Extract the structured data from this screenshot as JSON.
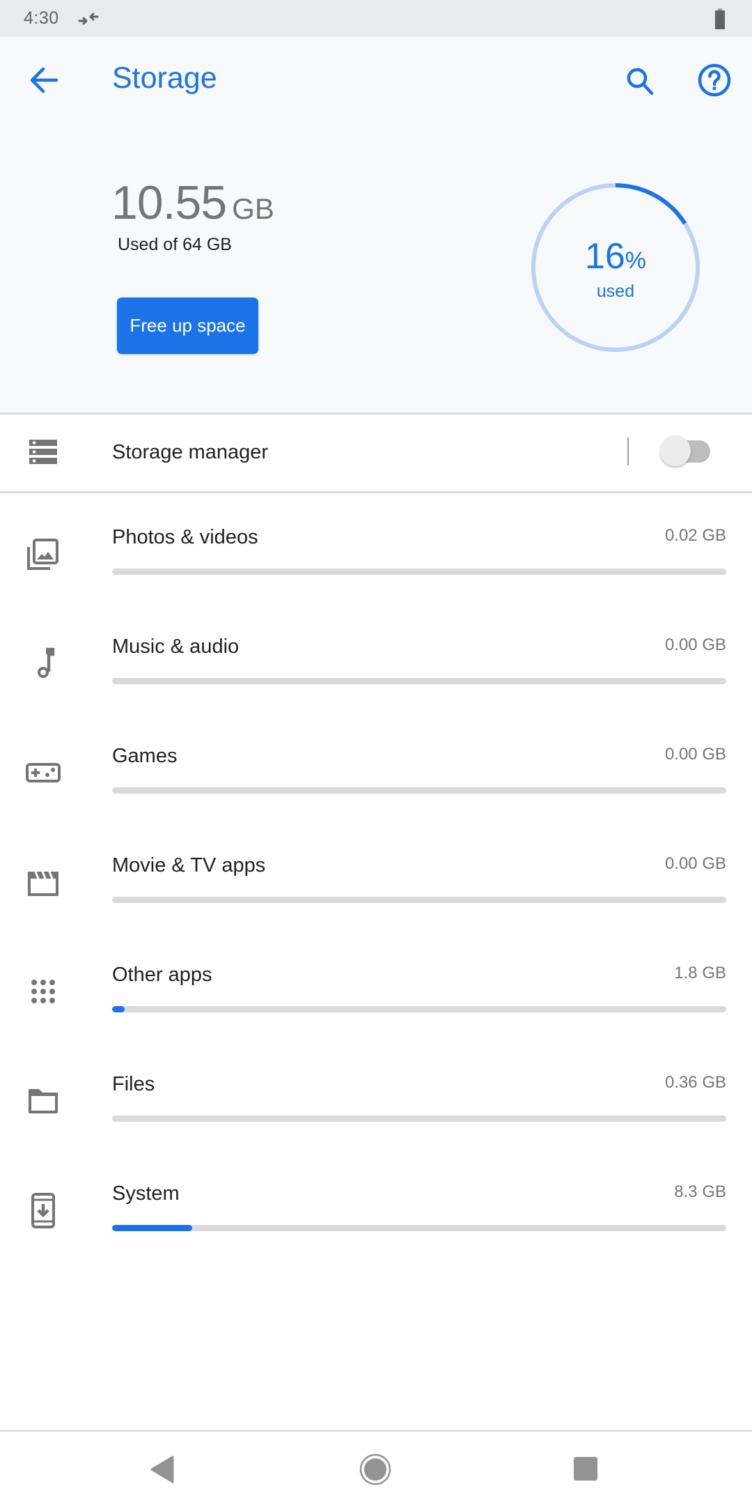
{
  "status_bar": {
    "time": "4:30",
    "icons": [
      "data-saver-icon",
      "battery-icon"
    ]
  },
  "header": {
    "title": "Storage",
    "back_icon": "arrow-back-icon",
    "search_icon": "search-icon",
    "help_icon": "help-circle-icon"
  },
  "summary": {
    "used_value": "10.55",
    "used_unit": "GB",
    "used_of": "Used of 64 GB",
    "free_up_button": "Free up space",
    "percent_value": "16",
    "percent_sign": "%",
    "percent_label": "used",
    "percent_fraction": 0.16
  },
  "storage_manager": {
    "label": "Storage manager",
    "icon": "storage-icon",
    "enabled": false
  },
  "categories": [
    {
      "label": "Photos & videos",
      "size": "0.02 GB",
      "icon": "photo-library-icon",
      "fraction": 0.0
    },
    {
      "label": "Music & audio",
      "size": "0.00 GB",
      "icon": "music-note-icon",
      "fraction": 0.0
    },
    {
      "label": "Games",
      "size": "0.00 GB",
      "icon": "gamepad-icon",
      "fraction": 0.0
    },
    {
      "label": "Movie & TV apps",
      "size": "0.00 GB",
      "icon": "movie-clapper-icon",
      "fraction": 0.0
    },
    {
      "label": "Other apps",
      "size": "1.8 GB",
      "icon": "apps-grid-icon",
      "fraction": 0.02
    },
    {
      "label": "Files",
      "size": "0.36 GB",
      "icon": "folder-icon",
      "fraction": 0.0
    },
    {
      "label": "System",
      "size": "8.3 GB",
      "icon": "system-update-icon",
      "fraction": 0.13
    }
  ],
  "colors": {
    "accent": "#1a73e8",
    "accent_light": "#b8d3f6",
    "header_bg": "#f8f9fa",
    "icon_gray": "#757575",
    "bar_track": "#dadada"
  },
  "nav_bar": {
    "buttons": [
      "nav-back-icon",
      "nav-home-icon",
      "nav-recents-icon"
    ]
  }
}
